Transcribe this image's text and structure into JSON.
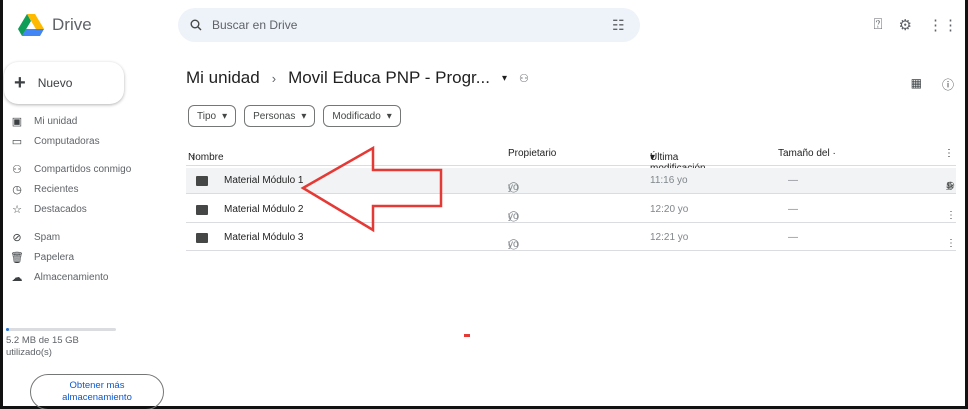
{
  "app": {
    "name": "Drive"
  },
  "search": {
    "placeholder": "Buscar en Drive"
  },
  "sidebar": {
    "new_label": "Nuevo",
    "items": [
      {
        "label": "Mi unidad",
        "icon": "my-drive-icon"
      },
      {
        "label": "Computadoras",
        "icon": "computer-icon"
      },
      {
        "label": "Compartidos conmigo",
        "icon": "shared-icon"
      },
      {
        "label": "Recientes",
        "icon": "clock-icon"
      },
      {
        "label": "Destacados",
        "icon": "star-icon"
      },
      {
        "label": "Spam",
        "icon": "spam-icon"
      },
      {
        "label": "Papelera",
        "icon": "trash-icon"
      },
      {
        "label": "Almacenamiento",
        "icon": "cloud-icon"
      }
    ],
    "storage_fraction": 0.03,
    "storage_text": "5.2 MB de 15 GB utilizado(s)",
    "get_more_line1": "Obtener más",
    "get_more_line2": "almacenamiento"
  },
  "breadcrumb": {
    "root": "Mi unidad",
    "current": "Movil Educa PNP - Progr..."
  },
  "filters": [
    "Tipo",
    "Personas",
    "Modificado"
  ],
  "table": {
    "headers": {
      "name": "Nombre",
      "owner": "Propietario",
      "modified": "Última modificación",
      "size": "Tamaño del ·"
    },
    "rows": [
      {
        "name": "Material Módulo 1",
        "owner": "yo",
        "modified": "11:16 yo",
        "size": "—"
      },
      {
        "name": "Material Módulo 2",
        "owner": "yo",
        "modified": "12:20 yo",
        "size": "—"
      },
      {
        "name": "Material Módulo 3",
        "owner": "yo",
        "modified": "12:21 yo",
        "size": "—"
      }
    ]
  },
  "colors": {
    "accent": "#1a73e8",
    "arrow": "#e53935"
  }
}
